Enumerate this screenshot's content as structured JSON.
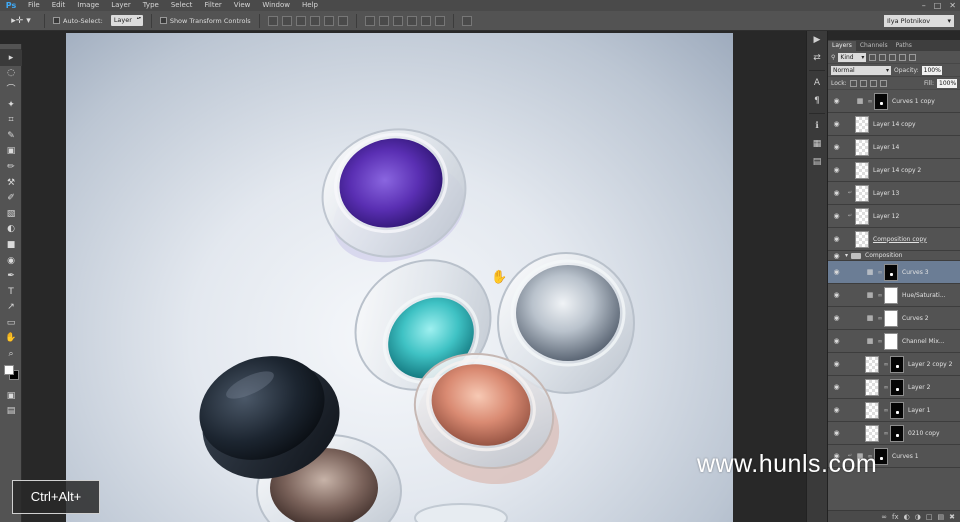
{
  "app": {
    "logo": "Ps",
    "window_controls": [
      "–",
      "□",
      "✕"
    ]
  },
  "menu": [
    "File",
    "Edit",
    "Image",
    "Layer",
    "Type",
    "Select",
    "Filter",
    "View",
    "Window",
    "Help"
  ],
  "options_bar": {
    "tool_glyph": "▸✛ ▾",
    "auto_select_label": "Auto-Select:",
    "auto_select_value": "Layer",
    "show_transform_label": "Show Transform Controls",
    "workspace": "Ilya Plotnikov"
  },
  "tools": [
    "▸",
    "◌",
    "⌒",
    "✦",
    "⌗",
    "✎",
    "▣",
    "✏",
    "⚒",
    "✐",
    "▧",
    "◐",
    "■",
    "◉",
    "✒",
    "T",
    "↗",
    "▭",
    "✋",
    "⌕"
  ],
  "dock": [
    "▶",
    "⇄",
    "A",
    "¶",
    "ℹ",
    "▦",
    "▤"
  ],
  "layers_panel": {
    "tabs": [
      "Layers",
      "Channels",
      "Paths"
    ],
    "filter_kind": "Kind",
    "blend_mode": "Normal",
    "opacity_label": "Opacity:",
    "opacity_value": "100%",
    "lock_label": "Lock:",
    "fill_label": "Fill:",
    "fill_value": "100%",
    "layers": [
      {
        "name": "Curves 1 copy",
        "type": "adjustment",
        "mask": "black"
      },
      {
        "name": "Layer 14 copy",
        "type": "pixel"
      },
      {
        "name": "Layer 14",
        "type": "pixel"
      },
      {
        "name": "Layer 14 copy 2",
        "type": "pixel"
      },
      {
        "name": "Layer 13",
        "type": "pixel",
        "clipped": true
      },
      {
        "name": "Layer 12",
        "type": "pixel",
        "clipped": true
      },
      {
        "name": "Composition copy",
        "type": "pixel",
        "underline": true
      },
      {
        "name": "Composition",
        "type": "group"
      },
      {
        "name": "Curves 3",
        "type": "adjustment",
        "mask": "black",
        "selected": true
      },
      {
        "name": "Hue/Saturati...",
        "type": "adjustment",
        "mask": "white"
      },
      {
        "name": "Curves 2",
        "type": "adjustment",
        "mask": "white"
      },
      {
        "name": "Channel Mix...",
        "type": "adjustment",
        "mask": "white"
      },
      {
        "name": "Layer 2 copy 2",
        "type": "pixel",
        "mask": "black"
      },
      {
        "name": "Layer 2",
        "type": "pixel",
        "mask": "black"
      },
      {
        "name": "Layer 1",
        "type": "pixel",
        "mask": "black"
      },
      {
        "name": "0210 copy",
        "type": "pixel",
        "mask": "black"
      },
      {
        "name": "Curves 1",
        "type": "adjustment",
        "mask": "black",
        "clipped": true
      }
    ],
    "footer_icons": [
      "∞",
      "fx",
      "◐",
      "◑",
      "□",
      "▤",
      "✖"
    ]
  },
  "overlay": {
    "shortcut": "Ctrl+Alt+",
    "watermark": "www.hunls.com"
  }
}
